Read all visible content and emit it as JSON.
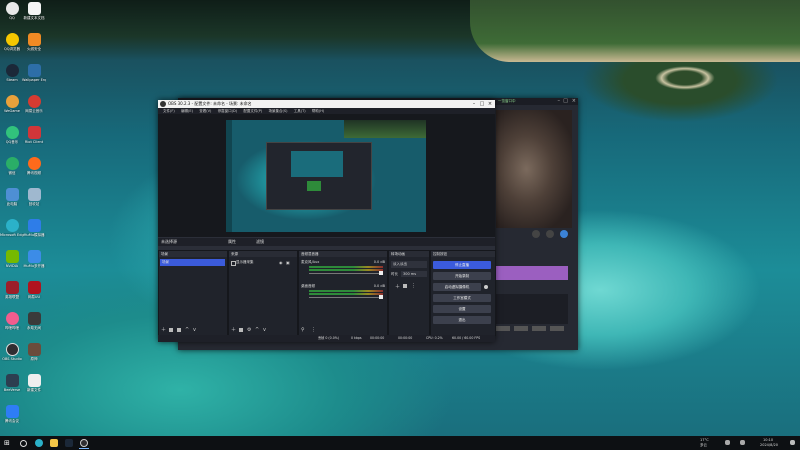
{
  "desktop_icons": [
    {
      "label": "QQ",
      "color": "#e8e8e8"
    },
    {
      "label": "新建文本文档",
      "color": "#f5f5f5"
    },
    {
      "label": "QQ浏览器",
      "color": "#f6c700"
    },
    {
      "label": "火绒安全",
      "color": "#f08a24"
    },
    {
      "label": "Steam",
      "color": "#1b2838"
    },
    {
      "label": "Wallpaper Engine",
      "color": "#2d6ea8"
    },
    {
      "label": "WeGame",
      "color": "#e9a13b"
    },
    {
      "label": "网易云音乐",
      "color": "#d63b32"
    },
    {
      "label": "QQ音乐",
      "color": "#31c27c"
    },
    {
      "label": "Riot Client",
      "color": "#d13639"
    },
    {
      "label": "微信",
      "color": "#2aae67"
    },
    {
      "label": "腾讯视频",
      "color": "#ff6a1b"
    },
    {
      "label": "此电脑",
      "color": "#4e8fd4"
    },
    {
      "label": "回收站",
      "color": "#9fb8cf"
    },
    {
      "label": "Microsoft Edge",
      "color": "#2bb1c9"
    },
    {
      "label": "MuMu模拟器",
      "color": "#2e7de8"
    },
    {
      "label": "NVIDIA",
      "color": "#76b900"
    },
    {
      "label": "MuMu多开器",
      "color": "#3c8ce7"
    },
    {
      "label": "英雄联盟",
      "color": "#9c1e2a"
    },
    {
      "label": "网易UU",
      "color": "#b0131e"
    },
    {
      "label": "哔哩哔哩",
      "color": "#f25d8e"
    },
    {
      "label": "永劫无间",
      "color": "#3a3a3a"
    },
    {
      "label": "OBS Studio",
      "color": "#302e31"
    },
    {
      "label": "原神",
      "color": "#6a4c3c"
    },
    {
      "label": "BeeVerse",
      "color": "#2d3e50"
    },
    {
      "label": "新建文件",
      "color": "#eeeeee"
    },
    {
      "label": "腾讯会议",
      "color": "#2e7df5"
    }
  ],
  "obs_main": {
    "title": "OBS 30.2.3 - 配置文件: 未命名 - 场景: 未命名",
    "menu": [
      "文件(F)",
      "编辑(E)",
      "查看(V)",
      "停靠窗口(D)",
      "配置文件(P)",
      "场景集合(S)",
      "工具(T)",
      "帮助(H)"
    ],
    "source_bar": {
      "label": "未选择源",
      "props": "属性",
      "filters": "滤镜"
    },
    "scenes": {
      "header": "场景",
      "items": [
        "场景"
      ]
    },
    "sources": {
      "header": "来源",
      "items": [
        "显示器采集"
      ]
    },
    "mixer": {
      "header": "音频混音器",
      "channels": [
        {
          "name": "麦克风/Aux",
          "db": "0.0 dB",
          "level": 0.72
        },
        {
          "name": "桌面音频",
          "db": "0.0 dB",
          "level": 0.55
        }
      ]
    },
    "transitions": {
      "header": "转场动画",
      "type": "淡入淡出",
      "duration_label": "时长",
      "duration": "300 ms"
    },
    "controls": {
      "header": "控制按钮",
      "buttons": [
        "停止直播",
        "开始录制",
        "启动虚拟摄像机",
        "工作室模式",
        "设置",
        "退出"
      ]
    },
    "status": {
      "frames": "丢帧 0 (0.0%)",
      "bitrate": "0 kbps",
      "live_time": "00:00:00",
      "rec_time": "00:00:00",
      "cpu": "CPU: 0.2%",
      "fps": "60.00 / 60.00 FPS"
    }
  },
  "obs_second": {
    "title_tag": "一览窗口中",
    "purple_bar_color": "#9b5fc0"
  },
  "taskbar": {
    "search_icon": "search-icon",
    "tray_temp": "17°C",
    "tray_weather": "多云",
    "time": "10:10",
    "date": "2024/8/20"
  },
  "colors": {
    "accent_blue": "#3b5bdb",
    "obs_bg": "#2b2e38",
    "obs_dock": "#20232b",
    "purple": "#9b5fc0"
  }
}
